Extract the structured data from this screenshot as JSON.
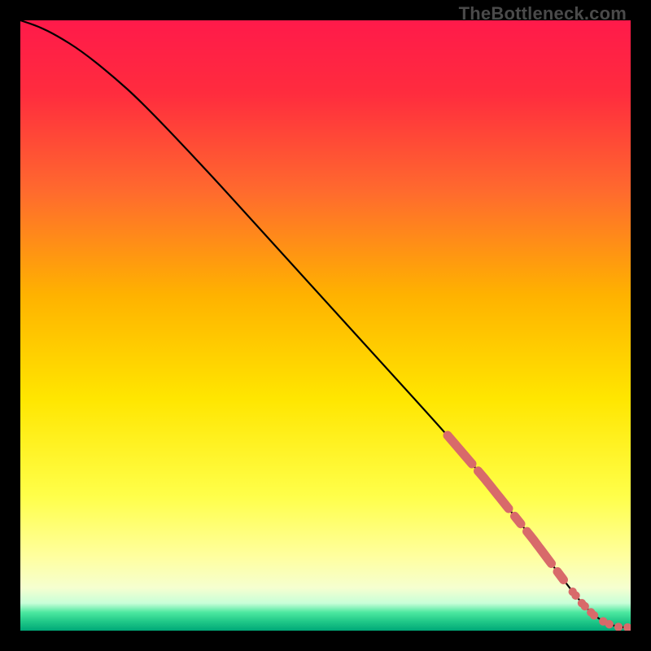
{
  "watermark": "TheBottleneck.com",
  "chart_data": {
    "type": "line",
    "title": "",
    "xlabel": "",
    "ylabel": "",
    "xlim": [
      0,
      100
    ],
    "ylim": [
      0,
      100
    ],
    "grid": false,
    "background_gradient": {
      "stops": [
        {
          "offset": 0.0,
          "color": "#ff1a4a"
        },
        {
          "offset": 0.12,
          "color": "#ff2c3e"
        },
        {
          "offset": 0.28,
          "color": "#ff6a2e"
        },
        {
          "offset": 0.45,
          "color": "#ffb200"
        },
        {
          "offset": 0.62,
          "color": "#ffe600"
        },
        {
          "offset": 0.78,
          "color": "#ffff4a"
        },
        {
          "offset": 0.88,
          "color": "#ffffa0"
        },
        {
          "offset": 0.93,
          "color": "#f5ffd0"
        },
        {
          "offset": 0.955,
          "color": "#c8ffd8"
        },
        {
          "offset": 0.97,
          "color": "#4de8a0"
        },
        {
          "offset": 0.985,
          "color": "#20c888"
        },
        {
          "offset": 1.0,
          "color": "#00a878"
        }
      ]
    },
    "series": [
      {
        "name": "main-curve",
        "x": [
          0,
          3,
          6,
          10,
          15,
          20,
          30,
          40,
          50,
          60,
          70,
          76,
          80,
          84,
          87,
          90,
          92,
          94,
          96,
          98,
          100
        ],
        "y": [
          100,
          99,
          97.5,
          95,
          91,
          86.5,
          76,
          65,
          54,
          43,
          32,
          25,
          20,
          15,
          11,
          7,
          4.5,
          2.5,
          1.2,
          0.6,
          0.5
        ]
      }
    ],
    "highlight_segments": [
      {
        "x_start": 70,
        "x_end": 74
      },
      {
        "x_start": 75,
        "x_end": 80
      },
      {
        "x_start": 81,
        "x_end": 82
      },
      {
        "x_start": 83,
        "x_end": 87
      },
      {
        "x_start": 88,
        "x_end": 89
      }
    ],
    "highlight_dots_x": [
      90.5,
      91,
      92,
      92.5,
      93.5,
      94,
      95.5,
      96.5,
      98,
      99.5
    ],
    "colors": {
      "curve": "#000000",
      "highlight": "#d86a6a"
    }
  }
}
